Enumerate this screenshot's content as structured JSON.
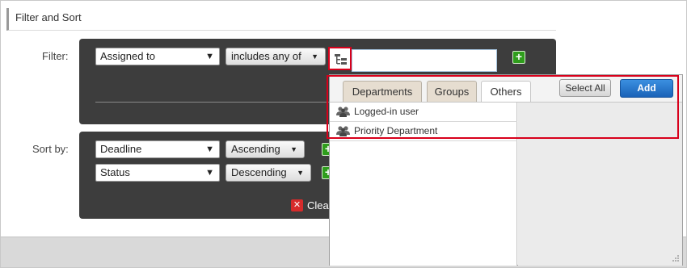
{
  "section": {
    "title": "Filter and Sort"
  },
  "filter": {
    "label": "Filter:",
    "field": "Assigned to",
    "operator": "includes any of",
    "value": ""
  },
  "sort": {
    "label": "Sort by:",
    "rows": [
      {
        "field": "Deadline",
        "order": "Ascending"
      },
      {
        "field": "Status",
        "order": "Descending"
      }
    ]
  },
  "clear": {
    "label": "Clear"
  },
  "popup": {
    "tabs": [
      {
        "label": "Departments",
        "active": false
      },
      {
        "label": "Groups",
        "active": false
      },
      {
        "label": "Others",
        "active": true
      }
    ],
    "select_all_label": "Select All",
    "add_label": "Add",
    "items": [
      {
        "label": "Logged-in user",
        "icon": "users-icon"
      },
      {
        "label": "Priority Department",
        "icon": "users-icon"
      }
    ]
  },
  "icons": {
    "dropdown": "triangle-down",
    "plus": "plus",
    "tree": "org-tree",
    "clear": "x-mark"
  },
  "colors": {
    "panel_bg": "#3d3d3d",
    "plus_green": "#2f9d1c",
    "add_blue": "#1a63b8",
    "highlight_red": "#d8001b",
    "tab_beige": "#e6ddd0"
  }
}
